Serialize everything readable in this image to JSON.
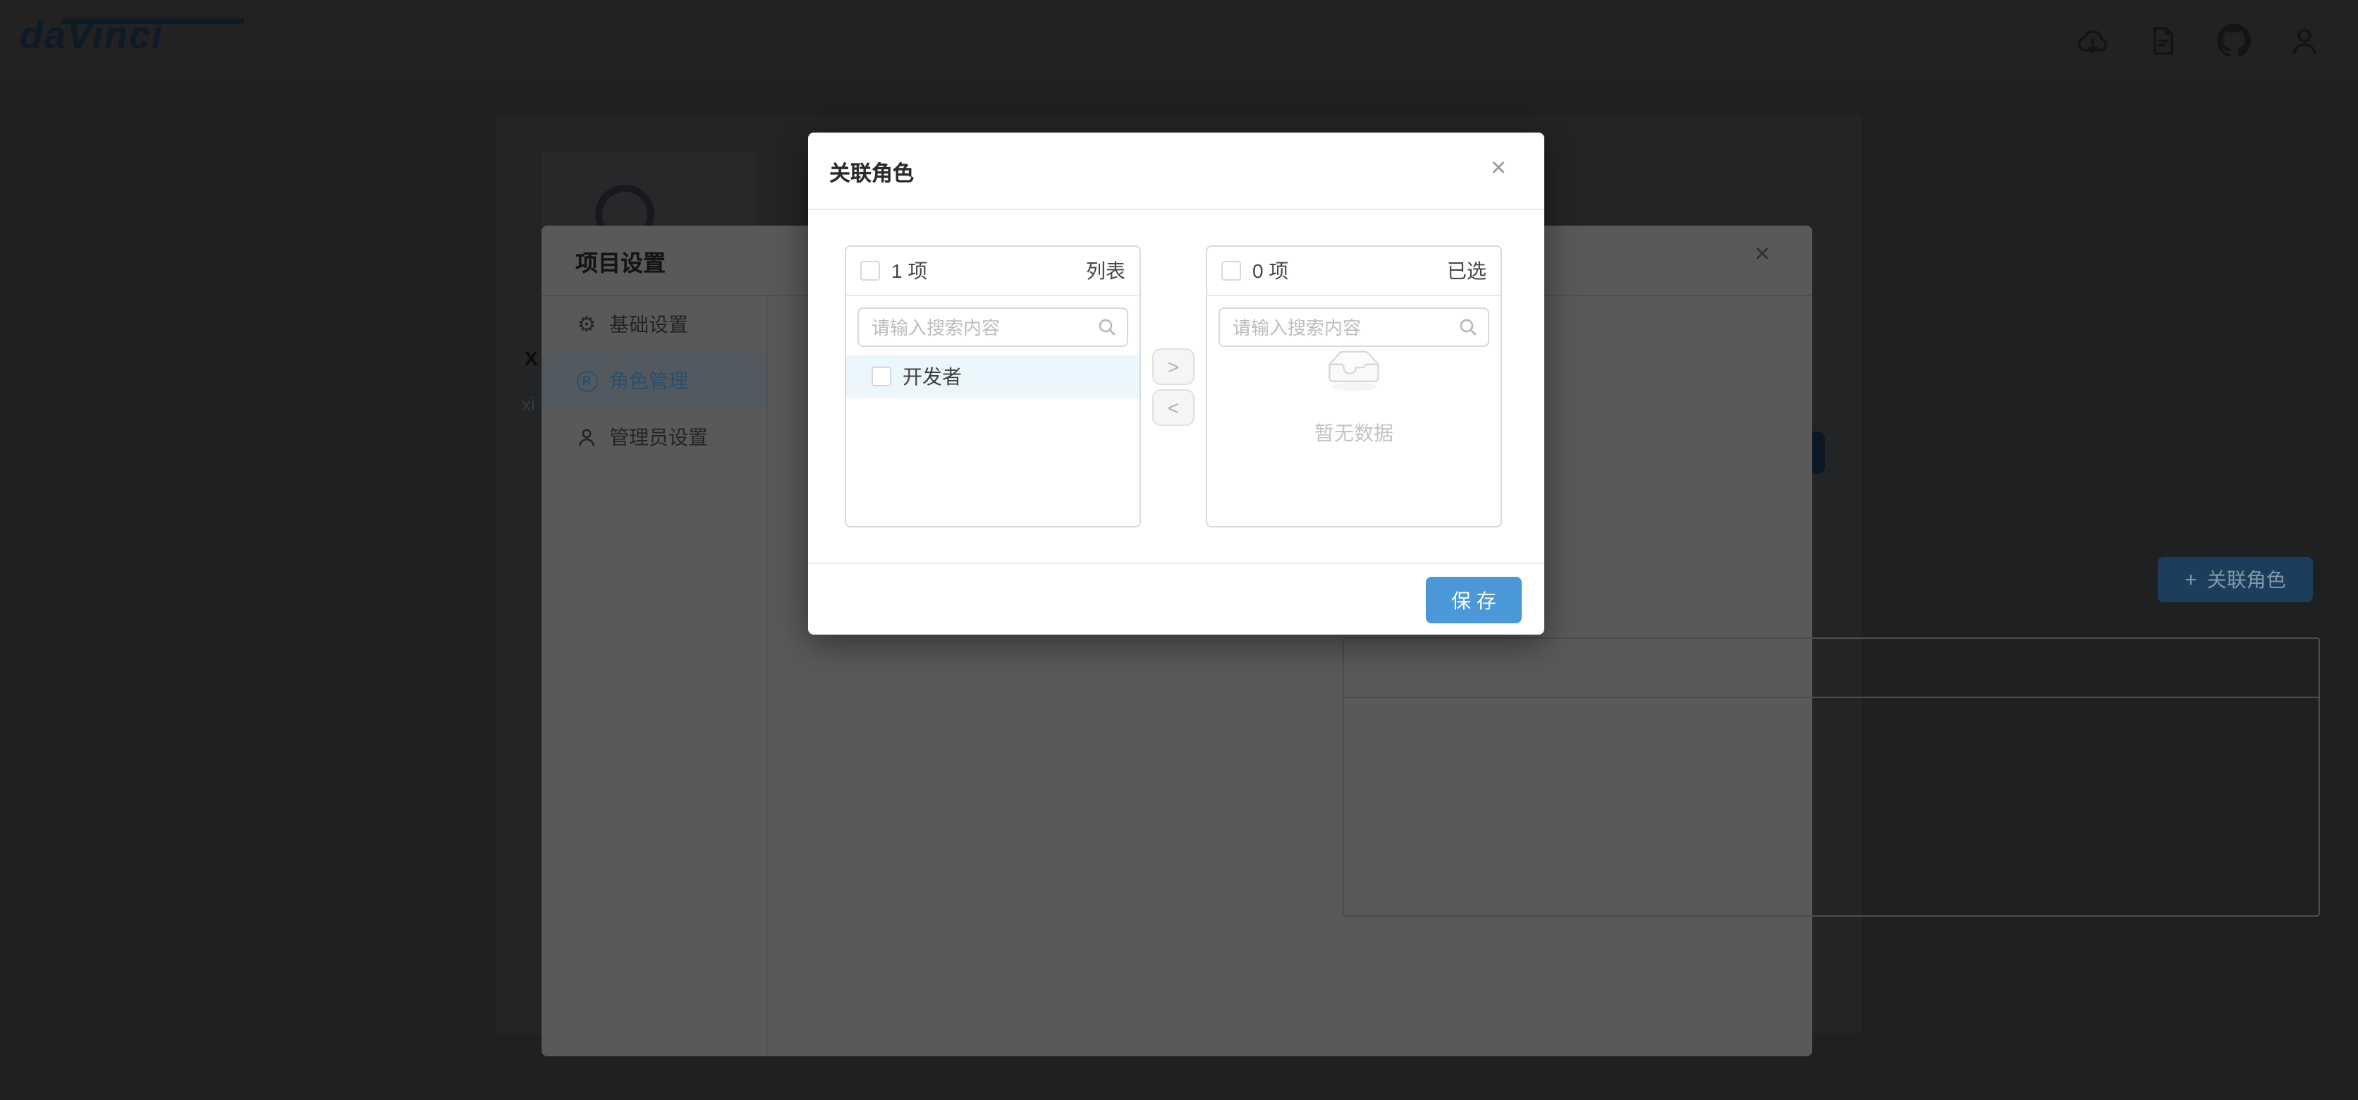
{
  "colors": {
    "primary": "#4a98d8",
    "row-highlight": "#ecf6fd",
    "header-bg": "#232121",
    "page-bg": "#1f2021",
    "dim-modal-bg": "#595959",
    "dim-border": "#4b4d4f",
    "dim-primary-btn": "#1c3e5c",
    "dim-selected": "#2a4e6e"
  },
  "header": {
    "logo": "daVinci",
    "icon_names": [
      "cloud-download-icon",
      "document-icon",
      "github-icon",
      "user-icon"
    ]
  },
  "background": {
    "partial_text_1": "X",
    "partial_text_2": "xi"
  },
  "project_settings": {
    "title": "项目设置",
    "close": "×",
    "menu": [
      {
        "label": "基础设置",
        "icon": "gear-icon",
        "selected": false
      },
      {
        "label": "角色管理",
        "icon": "registered-icon",
        "selected": true
      },
      {
        "label": "管理员设置",
        "icon": "person-icon",
        "selected": false
      }
    ],
    "registered_icon_letter": "R",
    "gear_glyph": "⚙",
    "plus": "+",
    "add_role_button": "关联角色"
  },
  "relate_roles_modal": {
    "title": "关联角色",
    "close": "×",
    "transfer": {
      "source": {
        "count": "1 项",
        "title": "列表",
        "search_placeholder": "请输入搜索内容",
        "items": [
          {
            "label": "开发者",
            "checked": false
          }
        ]
      },
      "target": {
        "count": "0 项",
        "title": "已选",
        "search_placeholder": "请输入搜索内容",
        "empty": "暂无数据"
      },
      "to_right": ">",
      "to_left": "<"
    },
    "save": "保 存"
  }
}
